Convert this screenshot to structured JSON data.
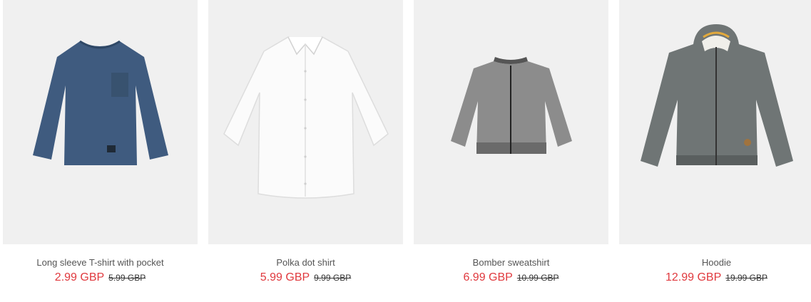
{
  "products": [
    {
      "name": "Long sleeve T-shirt with pocket",
      "price": "2.99 GBP",
      "old_price": "5.99 GBP",
      "image_icon": "long-sleeve-tshirt-icon",
      "colors": {
        "garment": "#3f5b7f"
      }
    },
    {
      "name": "Polka dot shirt",
      "price": "5.99 GBP",
      "old_price": "9.99 GBP",
      "image_icon": "shirt-icon",
      "colors": {
        "garment": "#fafafa"
      }
    },
    {
      "name": "Bomber sweatshirt",
      "price": "6.99 GBP",
      "old_price": "10.99 GBP",
      "image_icon": "bomber-jacket-icon",
      "colors": {
        "garment": "#8c8c8c"
      }
    },
    {
      "name": "Hoodie",
      "price": "12.99 GBP",
      "old_price": "19.99 GBP",
      "image_icon": "hoodie-icon",
      "colors": {
        "garment": "#6f7575"
      }
    }
  ],
  "colors": {
    "sale_price": "#e0393e",
    "card_background": "#f0f0f0"
  }
}
